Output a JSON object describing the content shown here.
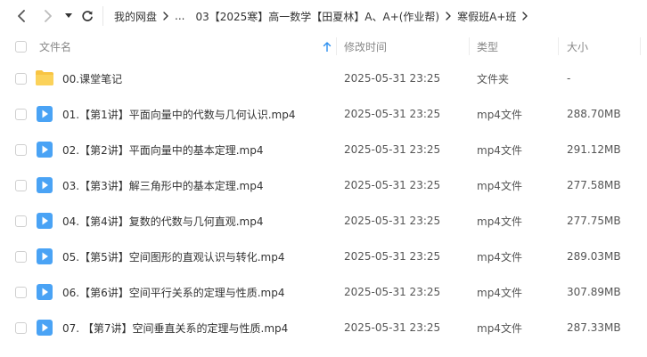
{
  "toolbar": {
    "back_icon": "chevron-left-icon",
    "forward_icon": "chevron-right-icon",
    "history_icon": "dropdown-triangle-icon",
    "refresh_icon": "refresh-icon"
  },
  "breadcrumb": [
    "我的网盘",
    "...",
    "03【2025寒】高一数学【田夏林】A、A+(作业帮)",
    "寒假班A+班"
  ],
  "columns": {
    "name": "文件名",
    "modified": "修改时间",
    "type": "类型",
    "size": "大小"
  },
  "files": [
    {
      "name": "00.课堂笔记",
      "modified": "2025-05-31 23:25",
      "type": "文件夹",
      "size": "-",
      "icon": "folder-icon"
    },
    {
      "name": "01.【第1讲】平面向量中的代数与几何认识.mp4",
      "modified": "2025-05-31 23:25",
      "type": "mp4文件",
      "size": "288.70MB",
      "icon": "video-file-icon"
    },
    {
      "name": "02.【第2讲】平面向量中的基本定理.mp4",
      "modified": "2025-05-31 23:25",
      "type": "mp4文件",
      "size": "291.12MB",
      "icon": "video-file-icon"
    },
    {
      "name": "03.【第3讲】解三角形中的基本定理.mp4",
      "modified": "2025-05-31 23:25",
      "type": "mp4文件",
      "size": "277.58MB",
      "icon": "video-file-icon"
    },
    {
      "name": "04.【第4讲】复数的代数与几何直观.mp4",
      "modified": "2025-05-31 23:25",
      "type": "mp4文件",
      "size": "277.75MB",
      "icon": "video-file-icon"
    },
    {
      "name": "05.【第5讲】空间图形的直观认识与转化.mp4",
      "modified": "2025-05-31 23:25",
      "type": "mp4文件",
      "size": "289.03MB",
      "icon": "video-file-icon"
    },
    {
      "name": "06.【第6讲】空间平行关系的定理与性质.mp4",
      "modified": "2025-05-31 23:25",
      "type": "mp4文件",
      "size": "307.89MB",
      "icon": "video-file-icon"
    },
    {
      "name": "07. 【第7讲】空间垂直关系的定理与性质.mp4",
      "modified": "2025-05-31 23:25",
      "type": "mp4文件",
      "size": "287.33MB",
      "icon": "video-file-icon"
    }
  ],
  "colors": {
    "accent": "#2b8ff0",
    "folder": "#f8c443",
    "video": "#4aa3f5"
  }
}
